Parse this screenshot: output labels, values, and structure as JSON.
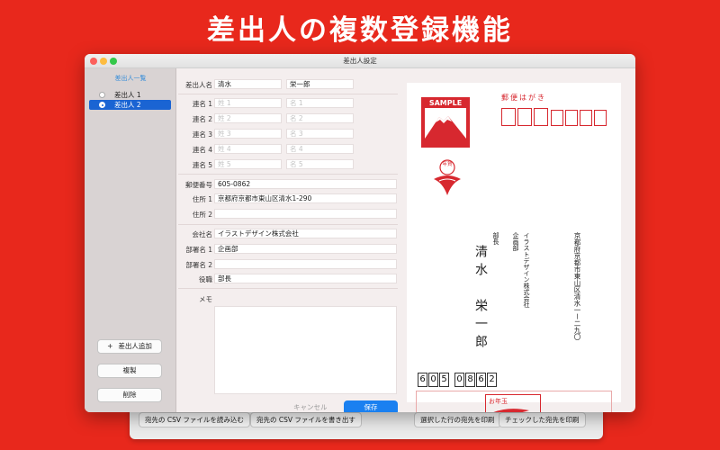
{
  "headline": "差出人の複数登録機能",
  "window": {
    "title": "差出人設定"
  },
  "sidebar": {
    "header": "差出人一覧",
    "items": [
      {
        "label": "差出人 1",
        "selected": false
      },
      {
        "label": "差出人 2",
        "selected": true
      }
    ],
    "add_button": "差出人追加",
    "duplicate_button": "複製",
    "delete_button": "削除"
  },
  "form": {
    "name_label": "差出人名",
    "last_name": "清水",
    "first_name": "栄一郎",
    "joint_labels": [
      "連名 1",
      "連名 2",
      "連名 3",
      "連名 4",
      "連名 5"
    ],
    "joint_last_placeholders": [
      "姓 1",
      "姓 2",
      "姓 3",
      "姓 4",
      "姓 5"
    ],
    "joint_first_placeholders": [
      "名 1",
      "名 2",
      "名 3",
      "名 4",
      "名 5"
    ],
    "zip_label": "郵便番号",
    "zip": "605-0862",
    "address1_label": "住所 1",
    "address1": "京都府京都市東山区清水1-290",
    "address2_label": "住所 2",
    "address2": "",
    "company_label": "会社名",
    "company": "イラストデザイン株式会社",
    "dept1_label": "部署名 1",
    "dept1": "企画部",
    "dept2_label": "部署名 2",
    "dept2": "",
    "title_label": "役職",
    "title": "部長",
    "memo_label": "メモ",
    "memo": "",
    "cancel": "キャンセル",
    "save": "保存"
  },
  "postcard": {
    "header": "郵便はがき",
    "stamp_label": "SAMPLE",
    "nenga_label": "年賀",
    "address": "京都府京都市東山区清水一ー二九〇",
    "company": "イラストデザイン株式会社",
    "department": "企画部",
    "title": "部長",
    "last_name": "清水",
    "first_name": "栄一郎",
    "zip_digits": [
      "6",
      "0",
      "5",
      "0",
      "8",
      "6",
      "2"
    ],
    "lottery_label": "お年玉"
  },
  "back_window": {
    "buttons": [
      "宛先の CSV ファイルを読み込む",
      "宛先の CSV ファイルを書き出す",
      "選択した行の宛先を印刷",
      "チェックした宛先を印刷"
    ]
  },
  "colors": {
    "background": "#e8281c",
    "accent_blue": "#1a80f0",
    "postal_red": "#d7282f"
  }
}
